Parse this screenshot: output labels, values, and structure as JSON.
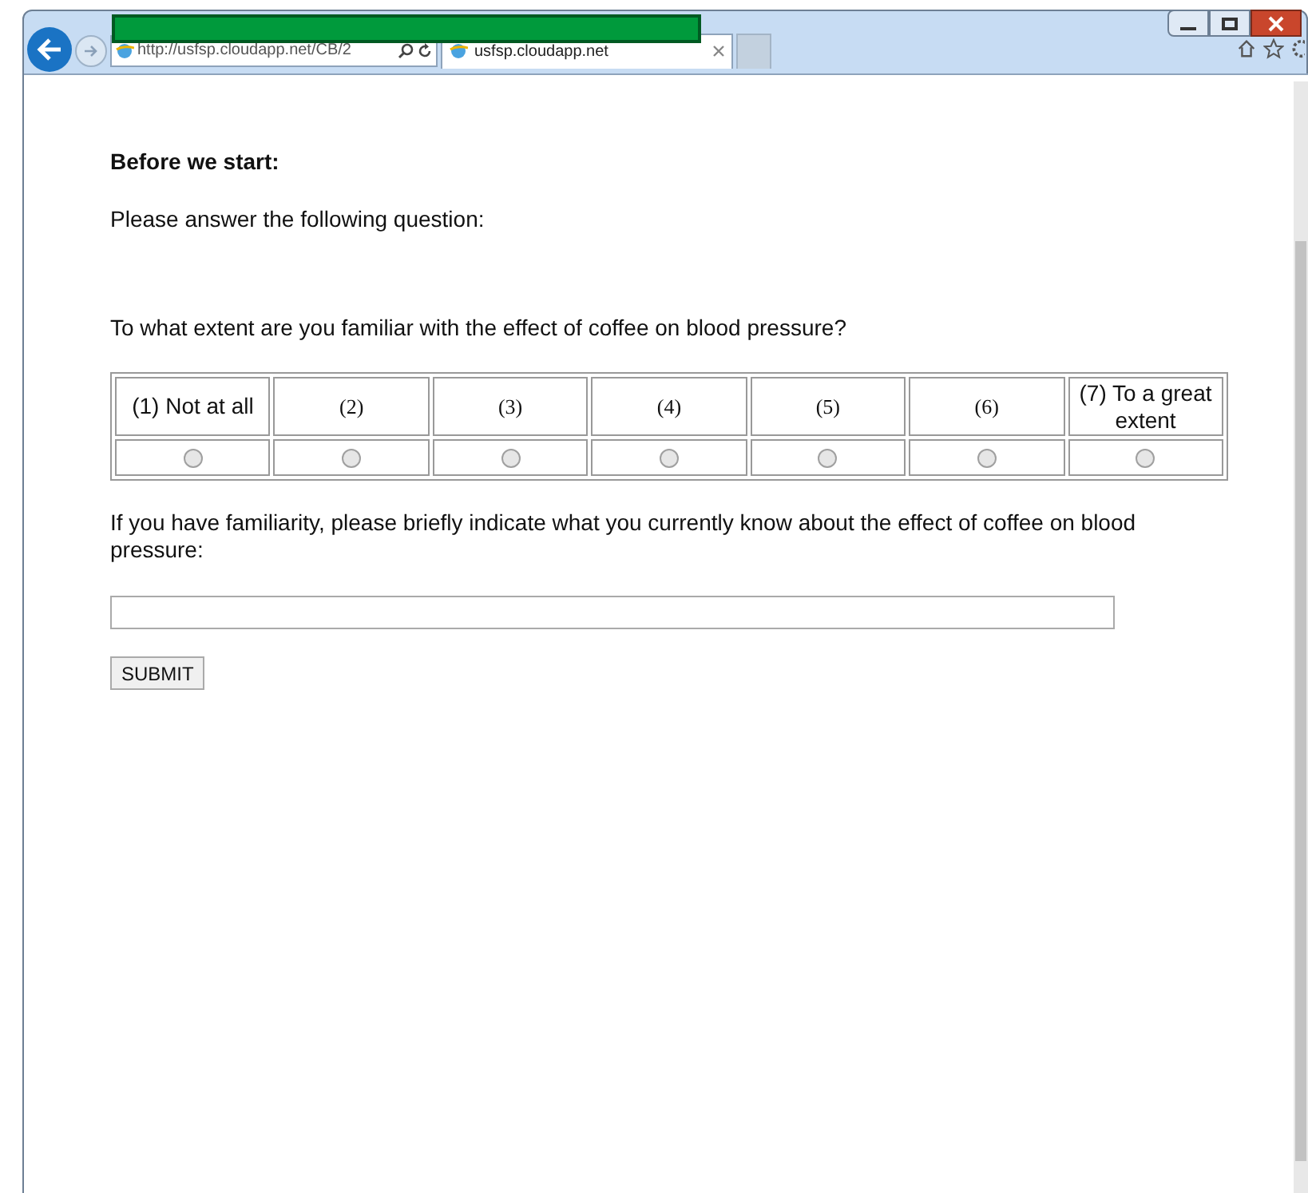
{
  "browser": {
    "address": "http://usfsp.cloudapp.net/CB/2",
    "tabs": [
      {
        "title": "usfsp.cloudapp.net",
        "selected": true
      }
    ]
  },
  "heading": "Before we start:",
  "intro": "Please answer the following question:",
  "question": "To what extent are you familiar with the effect of coffee on blood pressure?",
  "options": [
    {
      "label": "(1) Not at all",
      "kind": "sans",
      "selected": false
    },
    {
      "label": "(2)",
      "kind": "serif",
      "selected": false
    },
    {
      "label": "(3)",
      "kind": "serif",
      "selected": false
    },
    {
      "label": "(4)",
      "kind": "serif",
      "selected": false
    },
    {
      "label": "(5)",
      "kind": "serif",
      "selected": false
    },
    {
      "label": "(6)",
      "kind": "serif",
      "selected": false
    },
    {
      "label": "(7) To a great extent",
      "kind": "sans",
      "selected": false
    }
  ],
  "followup": "If you have familiarity, please briefly indicate what you currently know about the effect of coffee on blood pressure:",
  "submit": "SUBMIT"
}
